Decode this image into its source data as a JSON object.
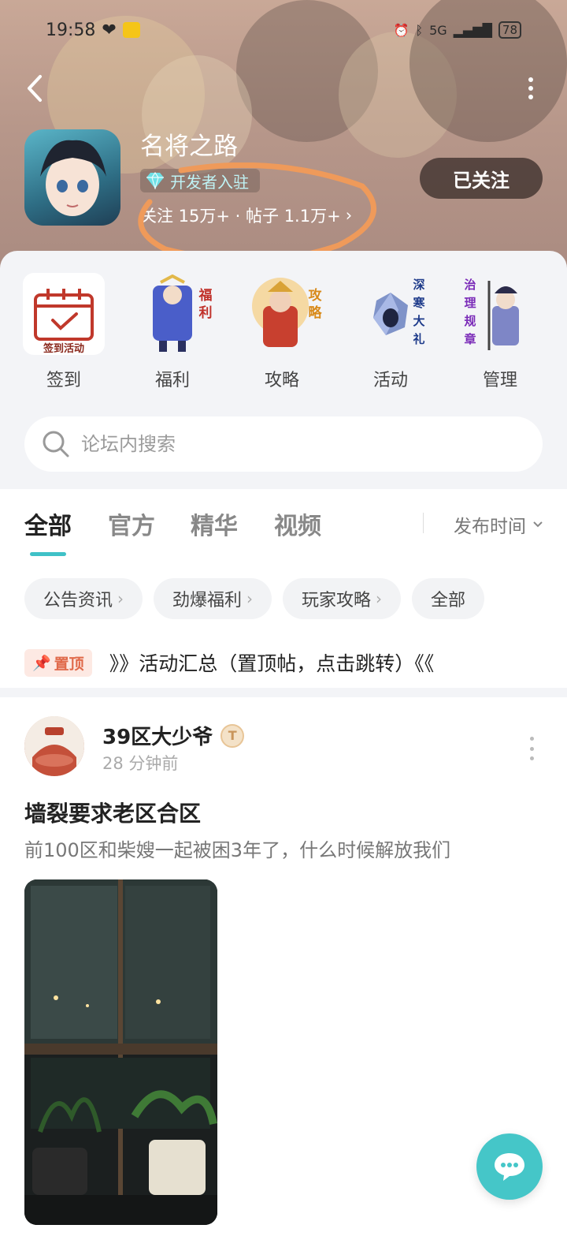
{
  "status_bar": {
    "time": "19:58",
    "network": "5G",
    "battery": "78"
  },
  "header": {
    "game_name": "名将之路",
    "developer_badge": "开发者入驻",
    "stats": "关注 15万+ · 帖子 1.1万+",
    "follow_button": "已关注"
  },
  "quick_links": [
    {
      "label": "签到",
      "caption": "签到活动"
    },
    {
      "label": "福利",
      "side_text": "福利"
    },
    {
      "label": "攻略",
      "side_text": "攻略"
    },
    {
      "label": "活动",
      "side_text": "深寒大礼"
    },
    {
      "label": "管理",
      "side_text": "治理规章"
    }
  ],
  "search": {
    "placeholder": "论坛内搜索"
  },
  "tabs": [
    {
      "label": "全部",
      "active": true
    },
    {
      "label": "官方",
      "active": false
    },
    {
      "label": "精华",
      "active": false
    },
    {
      "label": "视频",
      "active": false
    }
  ],
  "sort": {
    "label": "发布时间"
  },
  "chips": [
    {
      "label": "公告资讯"
    },
    {
      "label": "劲爆福利"
    },
    {
      "label": "玩家攻略"
    },
    {
      "label": "全部"
    }
  ],
  "pinned": {
    "badge": "置顶",
    "title": "》》活动汇总（置顶帖，点击跳转）《《"
  },
  "post": {
    "author": "39区大少爷",
    "level_badge": "T",
    "time": "28 分钟前",
    "title": "墙裂要求老区合区",
    "body": "前100区和柴嫂一起被困3年了，什么时候解放我们"
  },
  "colors": {
    "accent": "#3fc1c7",
    "fab": "#45c6c8",
    "pin": "#e0694a"
  }
}
